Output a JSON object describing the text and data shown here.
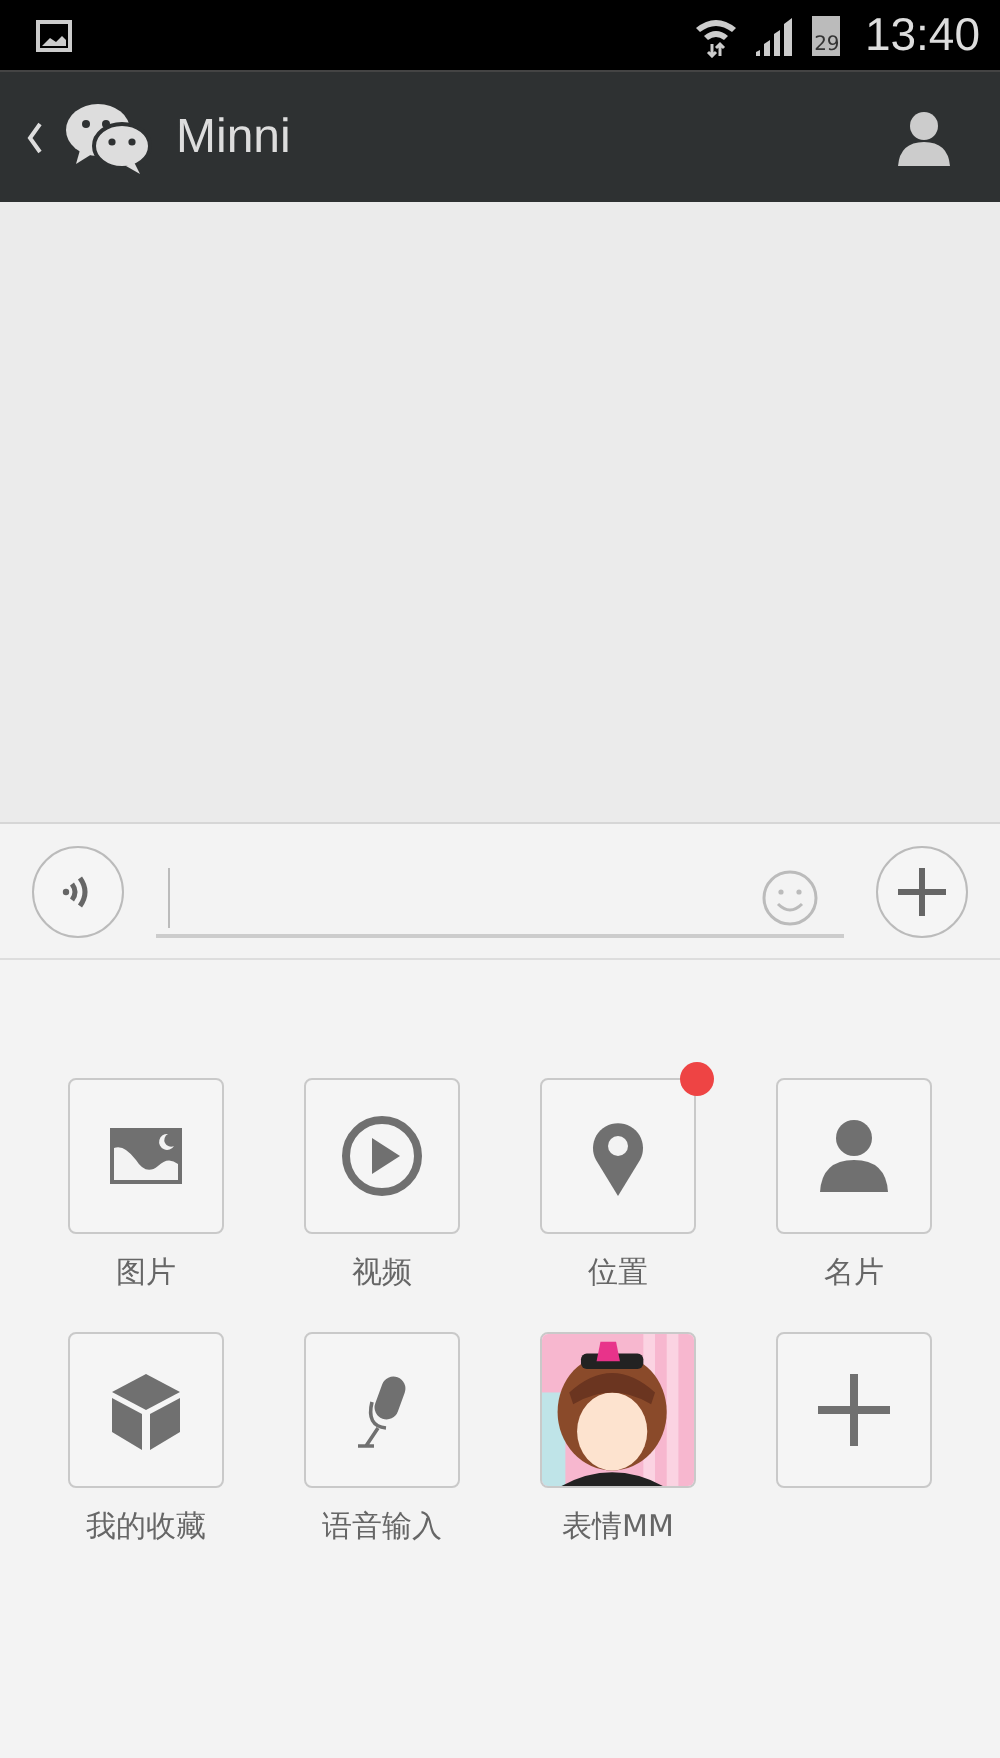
{
  "status_bar": {
    "battery": "29",
    "time": "13:40"
  },
  "header": {
    "title": "Minni"
  },
  "input_bar": {
    "placeholder_cursor": true
  },
  "apps": [
    {
      "label": "图片",
      "kind": "icon",
      "badge": false
    },
    {
      "label": "视频",
      "kind": "icon",
      "badge": false
    },
    {
      "label": "位置",
      "kind": "icon",
      "badge": true
    },
    {
      "label": "名片",
      "kind": "icon",
      "badge": false
    },
    {
      "label": "我的收藏",
      "kind": "icon",
      "badge": false
    },
    {
      "label": "语音输入",
      "kind": "icon",
      "badge": false
    },
    {
      "label": "表情MM",
      "kind": "picture",
      "badge": false
    },
    {
      "kind": "icon",
      "badge": false
    }
  ]
}
